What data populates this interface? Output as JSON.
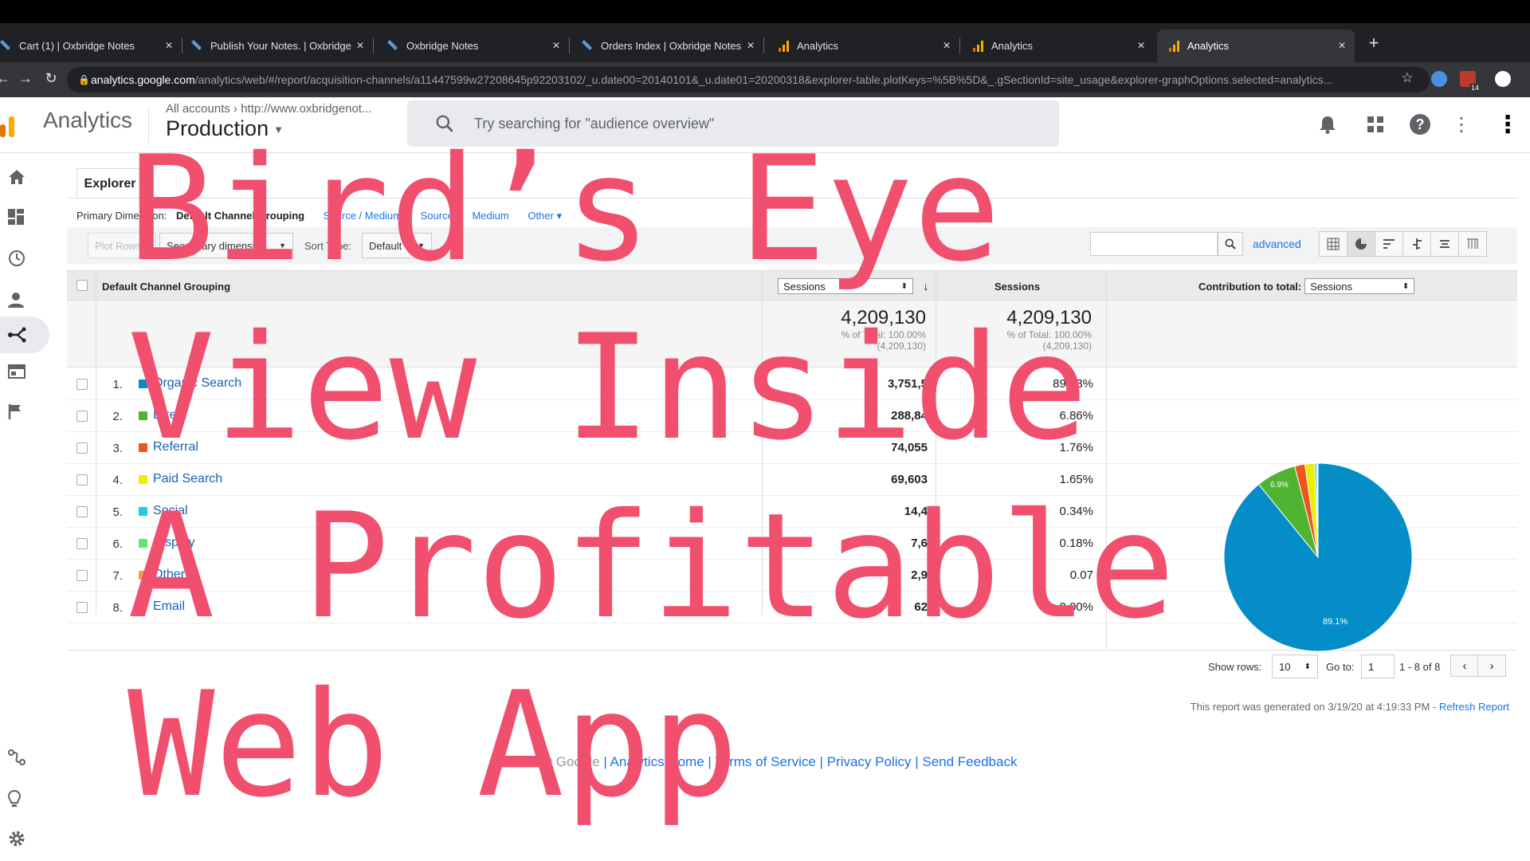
{
  "browser": {
    "tabs": [
      {
        "title": "Cart (1) | Oxbridge Notes",
        "favicon": "oxbridge"
      },
      {
        "title": "Publish Your Notes. | Oxbridge N",
        "favicon": "oxbridge"
      },
      {
        "title": "Oxbridge Notes",
        "favicon": "oxbridge"
      },
      {
        "title": "Orders Index | Oxbridge Notes",
        "favicon": "oxbridge"
      },
      {
        "title": "Analytics",
        "favicon": "analytics"
      },
      {
        "title": "Analytics",
        "favicon": "analytics"
      },
      {
        "title": "Analytics",
        "favicon": "analytics",
        "active": true
      }
    ],
    "new_tab": "+",
    "url_host": "analytics.google.com",
    "url_path": "/analytics/web/#/report/acquisition-channels/a11447599w27208645p92203102/_u.date00=20140101&_u.date01=20200318&explorer-table.plotKeys=%5B%5D&_.gSectionId=site_usage&explorer-graphOptions.selected=analytics...",
    "badge": "14"
  },
  "header": {
    "brand": "Analytics",
    "breadcrumb": "All accounts  ›  http://www.oxbridgenot...",
    "property": "Production",
    "search_placeholder": "Try searching for \"audience overview\""
  },
  "report": {
    "tab": "Explorer",
    "primary_dimension_label": "Primary Dimension:",
    "primary_dimension_selected": "Default Channel Grouping",
    "dimension_links": [
      "Source / Medium",
      "Source",
      "Medium",
      "Other ▾"
    ],
    "plot_rows": "Plot Rows",
    "secondary_dimension": "Secondary dimension",
    "sort_type_label": "Sort Type:",
    "sort_type": "Default",
    "advanced": "advanced",
    "col_dimension": "Default Channel Grouping",
    "col_metric_select": "Sessions",
    "col_metric": "Sessions",
    "contribution_label": "Contribution to total:",
    "contribution_select": "Sessions",
    "total_value": "4,209,130",
    "total_pct": "% of Total: 100.00%",
    "total_abs": "(4,209,130)",
    "total_value_2": "4,209,130",
    "total_pct_2": "% of Total: 100.00%",
    "total_abs_2": "(4,209,130)",
    "rows": [
      {
        "idx": "1.",
        "name": "Organic Search",
        "sessions": "3,751,5",
        "pct": "89.13%",
        "color": "#058dc7"
      },
      {
        "idx": "2.",
        "name": "Direct",
        "sessions": "288,84",
        "pct": "6.86%",
        "color": "#50b432"
      },
      {
        "idx": "3.",
        "name": "Referral",
        "sessions": "74,055",
        "pct": "1.76%",
        "color": "#ed561b"
      },
      {
        "idx": "4.",
        "name": "Paid Search",
        "sessions": "69,603",
        "pct": "1.65%",
        "color": "#edef00"
      },
      {
        "idx": "5.",
        "name": "Social",
        "sessions": "14,4",
        "pct": "0.34%",
        "color": "#24cbe5"
      },
      {
        "idx": "6.",
        "name": "Display",
        "sessions": "7,6",
        "pct": "0.18%",
        "color": "#64e572"
      },
      {
        "idx": "7.",
        "name": "Other",
        "sessions": "2,9",
        "pct": "0.07",
        "color": "#ff9655"
      },
      {
        "idx": "8.",
        "name": "Email",
        "sessions": "62",
        "pct": "0.00%",
        "color": "#fff263"
      }
    ],
    "pie_labels": {
      "big": "89.1%",
      "second": "6.9%"
    },
    "show_rows_label": "Show rows:",
    "show_rows": "10",
    "goto_label": "Go to:",
    "goto": "1",
    "range": "1 - 8 of 8",
    "generated": "This report was generated on 3/19/20 at 4:19:33 PM - ",
    "refresh": "Refresh Report"
  },
  "footer": {
    "copyright": "© 2020 Google",
    "links": [
      "Analytics Home",
      "Terms of Service",
      "Privacy Policy",
      "Send Feedback"
    ]
  },
  "overlay": {
    "lines": [
      "Bird’s Eye",
      "View Inside",
      "A Profitable",
      "Web App"
    ]
  },
  "colors": {
    "overlay": "#f0506e",
    "link": "#1a73e8"
  },
  "chart_data": {
    "type": "pie",
    "categories": [
      "Organic Search",
      "Direct",
      "Referral",
      "Paid Search",
      "Social",
      "Display",
      "Other",
      "Email"
    ],
    "values": [
      89.13,
      6.86,
      1.76,
      1.65,
      0.34,
      0.18,
      0.07,
      0.0
    ],
    "colors": [
      "#058dc7",
      "#50b432",
      "#ed561b",
      "#edef00",
      "#24cbe5",
      "#64e572",
      "#ff9655",
      "#fff263"
    ]
  }
}
